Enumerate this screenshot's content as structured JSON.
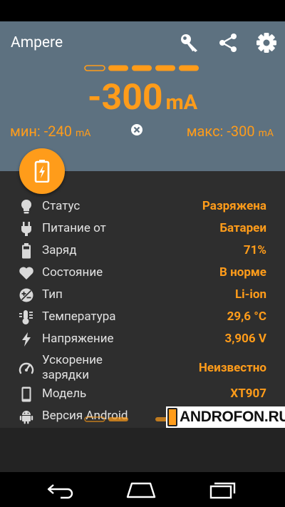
{
  "app": {
    "title": "Ampere"
  },
  "colors": {
    "accent": "#ff9c1a",
    "header_bg": "#5d7180",
    "content_bg": "#2e2e2e"
  },
  "toolbar": {
    "icons": [
      "key-icon",
      "share-icon",
      "settings-icon"
    ]
  },
  "reading": {
    "value": "-300",
    "unit": "mA",
    "min_label": "мин:",
    "min_value": "-240",
    "min_unit": "mA",
    "max_label": "макс:",
    "max_value": "-300",
    "max_unit": "mA"
  },
  "info": {
    "rows": [
      {
        "icon": "lightbulb-icon",
        "label": "Статус",
        "value": "Разряжена"
      },
      {
        "icon": "plug-icon",
        "label": "Питание от",
        "value": "Батареи"
      },
      {
        "icon": "battery-icon",
        "label": "Заряд",
        "value": "71%"
      },
      {
        "icon": "heart-icon",
        "label": "Состояние",
        "value": "В норме"
      },
      {
        "icon": "battery-type-icon",
        "label": "Тип",
        "value": "Li-ion"
      },
      {
        "icon": "thermometer-icon",
        "label": "Температура",
        "value": "29,6 °C"
      },
      {
        "icon": "lightning-icon",
        "label": "Напряжение",
        "value": "3,906 V"
      },
      {
        "icon": "speedometer-icon",
        "label": "Ускорение\nзарядки",
        "value": "Неизвестно"
      },
      {
        "icon": "phone-icon",
        "label": "Модель",
        "value": "XT907"
      },
      {
        "icon": "android-icon",
        "label": "Версия Android",
        "value": ""
      }
    ]
  },
  "watermark": {
    "text": "ANDROFON.RU"
  }
}
